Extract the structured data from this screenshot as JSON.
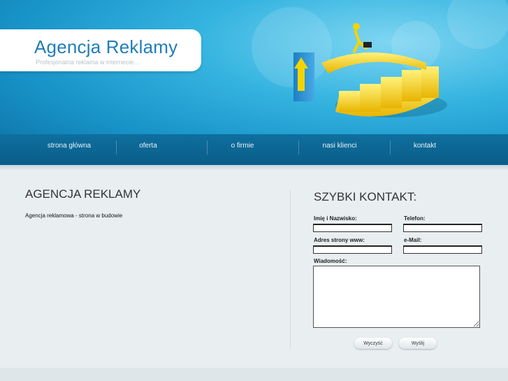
{
  "header": {
    "logo_title": "Agencja Reklamy",
    "logo_subtitle": "Profesjonalna reklama w internecie...",
    "brand_color": "#1f7eb8"
  },
  "nav": {
    "items": [
      {
        "label": "strona główna"
      },
      {
        "label": "oferta"
      },
      {
        "label": "o firmie"
      },
      {
        "label": "nasi klienci"
      },
      {
        "label": "kontakt"
      }
    ]
  },
  "main": {
    "title": "AGENCJA REKLAMY",
    "text": "Agencja reklamowa - strona w budowie"
  },
  "contact": {
    "title": "SZYBKI KONTAKT:",
    "fields": {
      "name_label": "Imię i Nazwisko:",
      "phone_label": "Telefon:",
      "www_label": "Adres strony www:",
      "email_label": "e-Mail:",
      "message_label": "Wiadomość:"
    },
    "buttons": {
      "clear_label": "Wyczyść",
      "send_label": "Wyślij"
    }
  }
}
